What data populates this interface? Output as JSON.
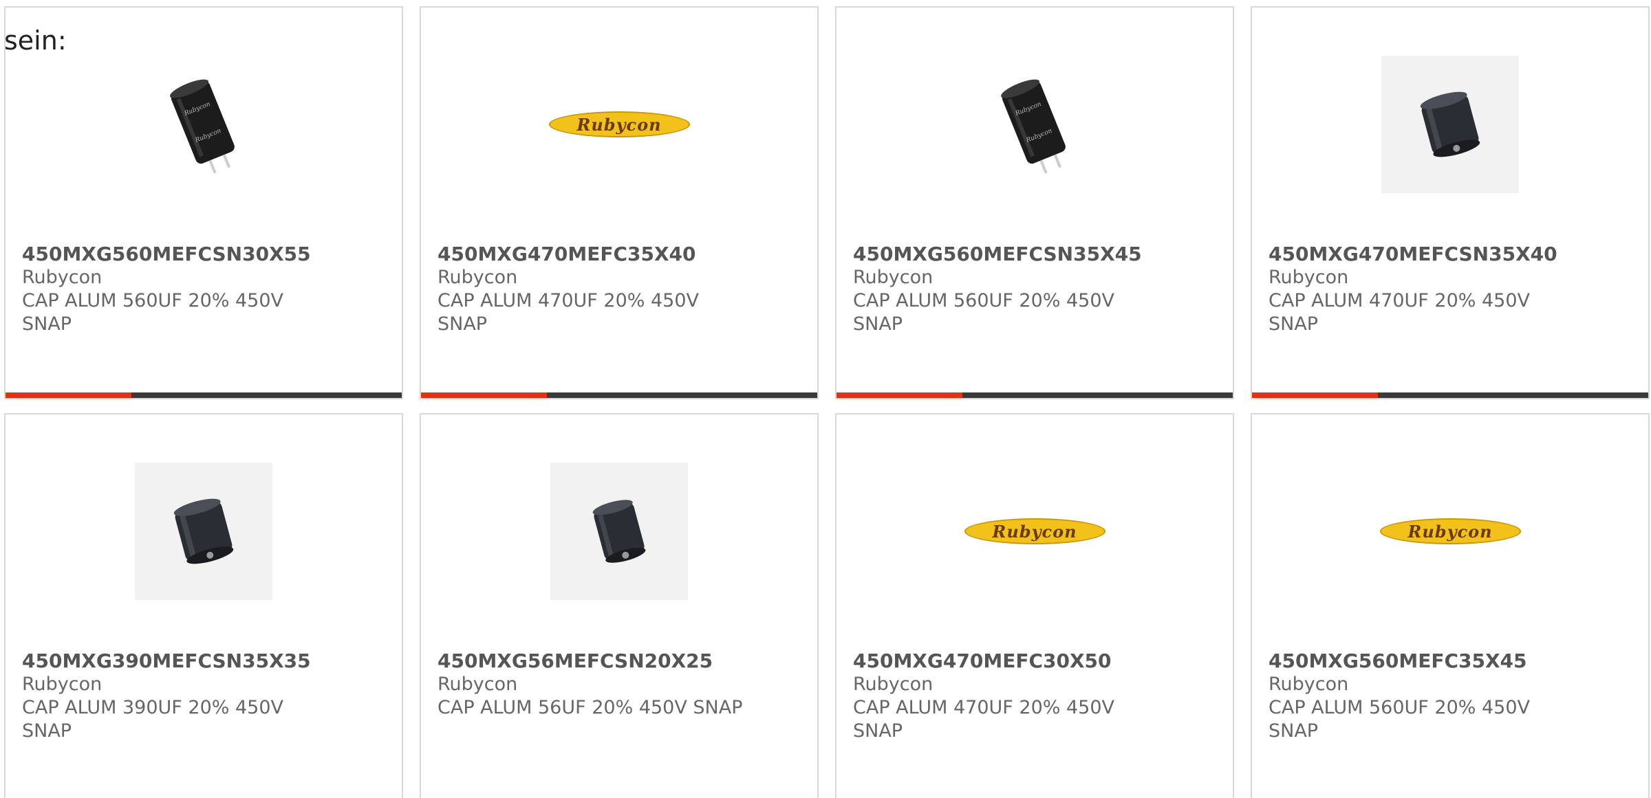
{
  "intro_text": "sein:",
  "products": [
    {
      "part_number": "450MXG560MEFCSN30X55",
      "manufacturer": "Rubycon",
      "description": "CAP ALUM 560UF 20% 450V SNAP",
      "image": "capacitor-tall-photo"
    },
    {
      "part_number": "450MXG470MEFC35X40",
      "manufacturer": "Rubycon",
      "description": "CAP ALUM 470UF 20% 450V SNAP",
      "image": "rubycon-logo",
      "logo_text": "Rubycon"
    },
    {
      "part_number": "450MXG560MEFCSN35X45",
      "manufacturer": "Rubycon",
      "description": "CAP ALUM 560UF 20% 450V SNAP",
      "image": "capacitor-tall-photo"
    },
    {
      "part_number": "450MXG470MEFCSN35X40",
      "manufacturer": "Rubycon",
      "description": "CAP ALUM 470UF 20% 450V SNAP",
      "image": "capacitor-short-photo"
    },
    {
      "part_number": "450MXG390MEFCSN35X35",
      "manufacturer": "Rubycon",
      "description": "CAP ALUM 390UF 20% 450V SNAP",
      "image": "capacitor-short-photo"
    },
    {
      "part_number": "450MXG56MEFCSN20X25",
      "manufacturer": "Rubycon",
      "description": "CAP ALUM 56UF 20% 450V SNAP",
      "image": "capacitor-short-photo"
    },
    {
      "part_number": "450MXG470MEFC30X50",
      "manufacturer": "Rubycon",
      "description": "CAP ALUM 470UF 20% 450V SNAP",
      "image": "rubycon-logo",
      "logo_text": "Rubycon"
    },
    {
      "part_number": "450MXG560MEFC35X45",
      "manufacturer": "Rubycon",
      "description": "CAP ALUM 560UF 20% 450V SNAP",
      "image": "rubycon-logo",
      "logo_text": "Rubycon"
    }
  ],
  "colors": {
    "accent_bar": "#e0330f",
    "bar_track": "#3a3a3a",
    "card_border": "#d9d9d9",
    "logo_yellow": "#f2c21b"
  }
}
